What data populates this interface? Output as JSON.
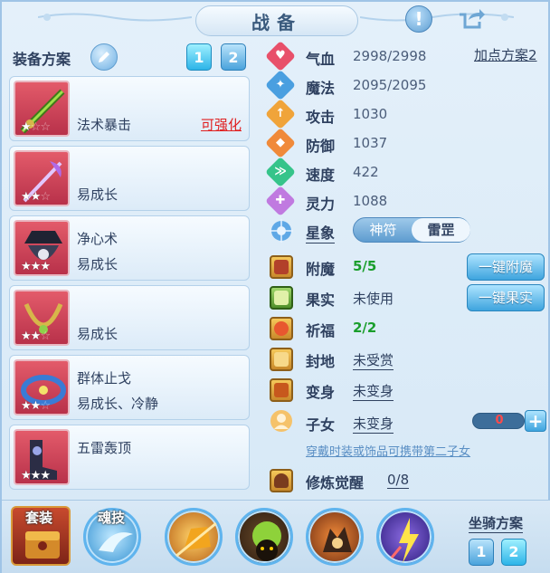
{
  "header": {
    "title": "战备",
    "help_glyph": "!",
    "share_icon": "share-icon"
  },
  "equipment": {
    "title": "装备方案",
    "plans": [
      "1",
      "2"
    ],
    "active_plan": "1",
    "slots": [
      {
        "line1": "",
        "line2": "法术暴击",
        "upgrade": "可强化",
        "stars": 1,
        "max_stars": 3,
        "icon": "green-sword-icon"
      },
      {
        "line1": "",
        "line2": "易成长",
        "upgrade": "",
        "stars": 2,
        "max_stars": 3,
        "icon": "purple-staff-icon"
      },
      {
        "line1": "净心术",
        "line2": "易成长",
        "upgrade": "",
        "stars": 3,
        "max_stars": 3,
        "icon": "hat-armor-icon"
      },
      {
        "line1": "",
        "line2": "易成长",
        "upgrade": "",
        "stars": 2,
        "max_stars": 3,
        "icon": "gold-necklace-icon"
      },
      {
        "line1": "群体止戈",
        "line2": "易成长、冷静",
        "upgrade": "",
        "stars": 2,
        "max_stars": 3,
        "icon": "red-belt-icon"
      },
      {
        "line1": "五雷轰顶",
        "line2": "",
        "upgrade": "",
        "stars": 3,
        "max_stars": 3,
        "icon": "dark-boots-icon"
      }
    ]
  },
  "stats": {
    "point_plan": "加点方案2",
    "rows": [
      {
        "label": "气血",
        "value": "2998/2998",
        "color": "#e8506a",
        "glyph": "♥"
      },
      {
        "label": "魔法",
        "value": "2095/2095",
        "color": "#4a9fe0",
        "glyph": "✦"
      },
      {
        "label": "攻击",
        "value": "1030",
        "color": "#f0a43a",
        "glyph": "↑"
      },
      {
        "label": "防御",
        "value": "1037",
        "color": "#f08a3a",
        "glyph": "◆"
      },
      {
        "label": "速度",
        "value": "422",
        "color": "#36c48a",
        "glyph": "≫"
      },
      {
        "label": "灵力",
        "value": "1088",
        "color": "#c07ae0",
        "glyph": "✚"
      }
    ]
  },
  "star_sign": {
    "label": "星象",
    "options": [
      "神符",
      "雷罡"
    ],
    "selected": "雷罡"
  },
  "extras": {
    "enchant": {
      "label": "附魔",
      "value": "5/5",
      "button": "一键附魔"
    },
    "fruit": {
      "label": "果实",
      "value": "未使用",
      "button": "一键果实"
    },
    "blessing": {
      "label": "祈福",
      "value": "2/2"
    },
    "land": {
      "label": "封地",
      "value": "未受赏"
    },
    "transform": {
      "label": "变身",
      "value": "未变身"
    },
    "child": {
      "label": "子女",
      "value": "未变身",
      "count": "0",
      "plus": "+"
    },
    "hint": "穿戴时装或饰品可携带第二子女",
    "cultivation": {
      "label": "修炼觉醒",
      "value": "0/8"
    }
  },
  "bottom": {
    "suit_label": "套装",
    "soul_skill_label": "魂技",
    "skills": [
      "fist-skill-icon",
      "slime-skill-icon",
      "beast-skill-icon",
      "lightning-skill-icon"
    ],
    "mount_label": "坐骑方案",
    "mount_plans": [
      "1",
      "2"
    ],
    "active_mount": "2"
  }
}
